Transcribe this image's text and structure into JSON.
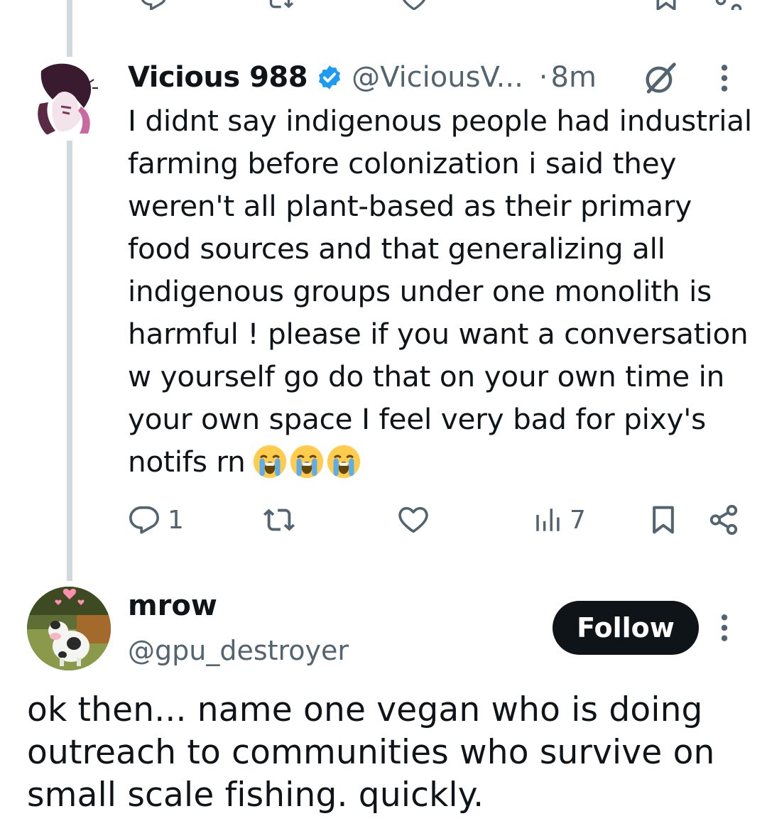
{
  "thread": {
    "tweet1": {
      "display_name": "Vicious 988",
      "handle": "@ViciousV...",
      "separator": "·",
      "time": "8m",
      "body": "I didnt say indigenous people had industrial farming before colonization i said they weren't all plant-based as their primary food sources and that generalizing all indigenous groups under one monolith is harmful ! please if you want a conversation w yourself go do that on your own time in your own space I feel very bad for pixy's notifs rn",
      "emojis": [
        "loudly-crying-face",
        "loudly-crying-face",
        "loudly-crying-face"
      ],
      "actions": {
        "reply_count": "1",
        "retweet_count": "",
        "like_count": "",
        "views_count": "7"
      }
    },
    "tweet2": {
      "display_name": "mrow",
      "handle": "@gpu_destroyer",
      "follow_label": "Follow",
      "body": "ok then... name one vegan who is doing outreach to communities who survive on small scale fishing. quickly."
    }
  },
  "colors": {
    "text": "#0f1419",
    "secondary": "#536471",
    "verified": "#1d9bf0",
    "thread_line": "#cfd9de",
    "follow_bg": "#0f1419"
  },
  "icons": {
    "verified": "verified-badge-icon",
    "grok": "grok-icon",
    "more": "more-vertical-icon",
    "reply": "reply-icon",
    "retweet": "retweet-icon",
    "like": "heart-icon",
    "views": "views-icon",
    "bookmark": "bookmark-icon",
    "share": "share-icon"
  }
}
